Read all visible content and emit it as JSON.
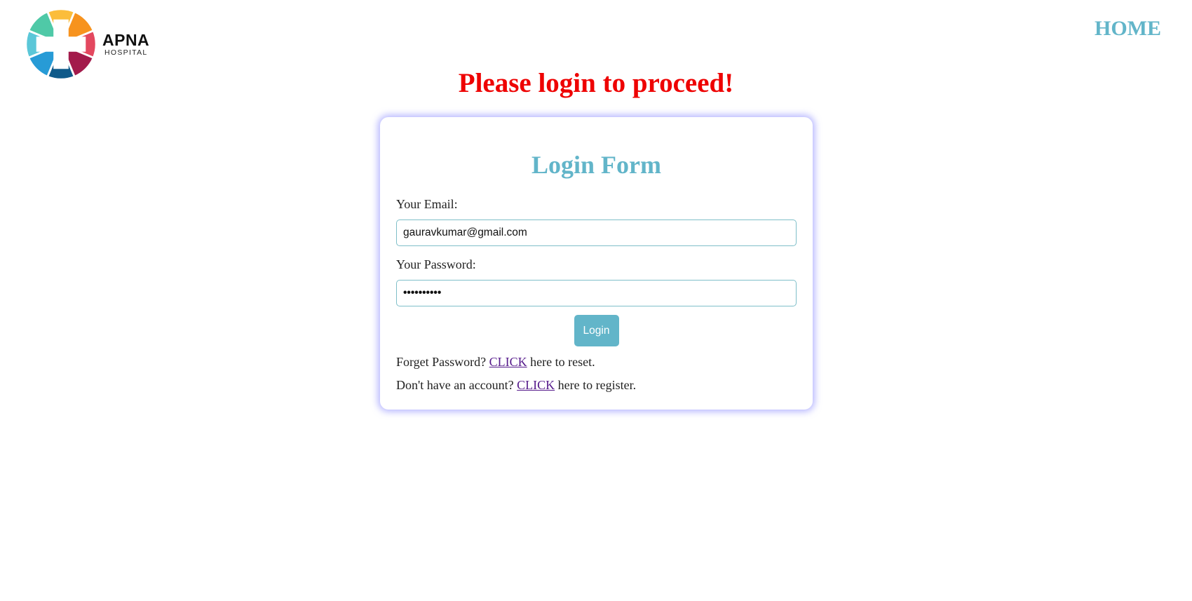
{
  "brand": {
    "name": "APNA",
    "subtitle": "HOSPITAL"
  },
  "nav": {
    "home": "HOME"
  },
  "headline": "Please login to proceed!",
  "form": {
    "title": "Login Form",
    "email_label": "Your Email:",
    "email_value": "gauravkumar@gmail.com",
    "password_label": "Your Password:",
    "password_value": "••••••••••",
    "login_button": "Login",
    "reset": {
      "prefix": "Forget Password? ",
      "link": "CLICK",
      "suffix": " here to reset."
    },
    "register": {
      "prefix": "Don't have an account? ",
      "link": "CLICK",
      "suffix": " here to register."
    }
  },
  "colors": {
    "accent": "#62b5c9",
    "alert": "#ee0000",
    "link": "#551a8b"
  }
}
